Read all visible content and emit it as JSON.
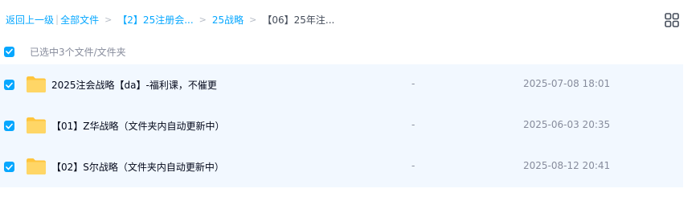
{
  "breadcrumb": {
    "back": "返回上一级",
    "all_files": "全部文件",
    "sep": ">",
    "crumbs": [
      "【2】25注册会...",
      "25战略"
    ],
    "current": "【06】25年注..."
  },
  "toolbar": {
    "grid_view_icon": "grid-view-icon"
  },
  "selection": {
    "label": "已选中3个文件/文件夹"
  },
  "colors": {
    "accent": "#06a7ff",
    "row_selected_bg": "#f2f8ff",
    "folder": "#ffc53d"
  },
  "files": [
    {
      "name": "2025注会战略【da】-福利课，不催更",
      "size": "-",
      "date": "2025-07-08 18:01"
    },
    {
      "name": "【01】Z华战略（文件夹内自动更新中）",
      "size": "-",
      "date": "2025-06-03 20:35"
    },
    {
      "name": "【02】S尔战略（文件夹内自动更新中）",
      "size": "-",
      "date": "2025-08-12 20:41"
    }
  ]
}
